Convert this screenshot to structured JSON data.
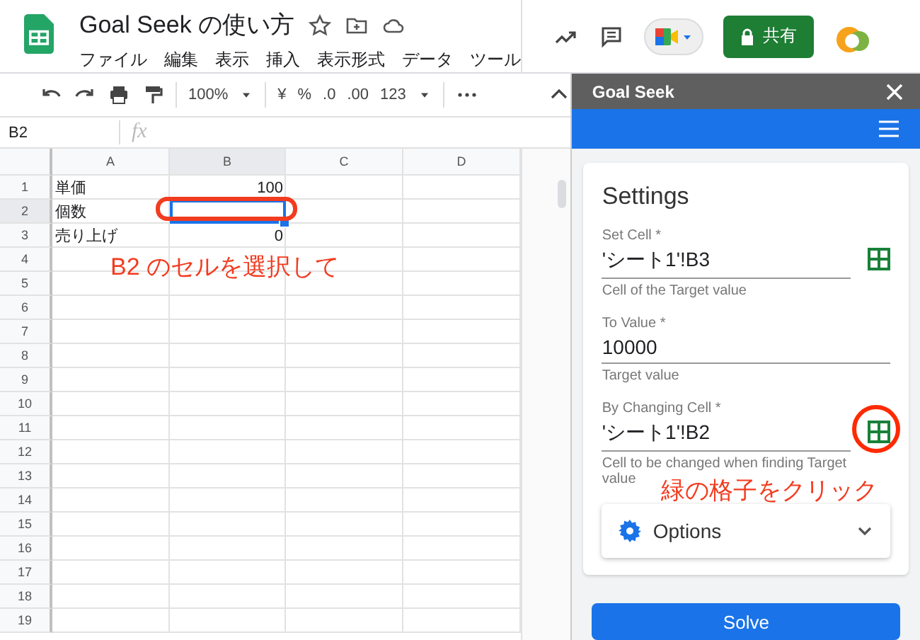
{
  "app": {
    "title": "Goal Seek の使い方",
    "menu": [
      "ファイル",
      "編集",
      "表示",
      "挿入",
      "表示形式",
      "データ",
      "ツール"
    ],
    "share_button": "共有"
  },
  "toolbar": {
    "zoom": "100%",
    "format_items": [
      "¥",
      "%",
      ".0",
      ".00"
    ],
    "number_format": "123"
  },
  "formula_bar": {
    "cell_ref": "B2",
    "fx": "fx"
  },
  "sheet": {
    "columns": [
      {
        "label": "A",
        "selected": false
      },
      {
        "label": "B",
        "selected": true
      },
      {
        "label": "C",
        "selected": false
      },
      {
        "label": "D",
        "selected": false
      }
    ],
    "rows": [
      {
        "number": "1",
        "selected": false,
        "a": "単価",
        "b": "100"
      },
      {
        "number": "2",
        "selected": true,
        "a": "個数"
      },
      {
        "number": "3",
        "selected": false,
        "a": "売り上げ",
        "b": "0"
      },
      {
        "number": "4",
        "selected": false
      },
      {
        "number": "5",
        "selected": false
      },
      {
        "number": "6",
        "selected": false
      },
      {
        "number": "7",
        "selected": false
      },
      {
        "number": "8",
        "selected": false
      },
      {
        "number": "9",
        "selected": false
      },
      {
        "number": "10",
        "selected": false
      },
      {
        "number": "11",
        "selected": false
      },
      {
        "number": "12",
        "selected": false
      },
      {
        "number": "13",
        "selected": false
      },
      {
        "number": "14",
        "selected": false
      },
      {
        "number": "15",
        "selected": false
      },
      {
        "number": "16",
        "selected": false
      },
      {
        "number": "17",
        "selected": false
      },
      {
        "number": "18",
        "selected": false
      },
      {
        "number": "19",
        "selected": false
      }
    ]
  },
  "panel": {
    "title": "Goal Seek",
    "heading": "Settings",
    "fields": [
      {
        "label": "Set Cell *",
        "value": "'シート1'!B3",
        "hint": "Cell of the Target value",
        "picker": true,
        "circled": false
      },
      {
        "label": "To Value *",
        "value": "10000",
        "hint": "Target value",
        "picker": false,
        "circled": false
      },
      {
        "label": "By Changing Cell *",
        "value": "'シート1'!B2",
        "hint": "Cell to be changed when finding Target value",
        "picker": true,
        "circled": true
      }
    ],
    "options": {
      "label": "Options",
      "expanded": false
    },
    "solve_button": "Solve"
  },
  "annotations": {
    "cell_note": "B2 のセルを選択して",
    "picker_note": "緑の格子をクリック"
  }
}
